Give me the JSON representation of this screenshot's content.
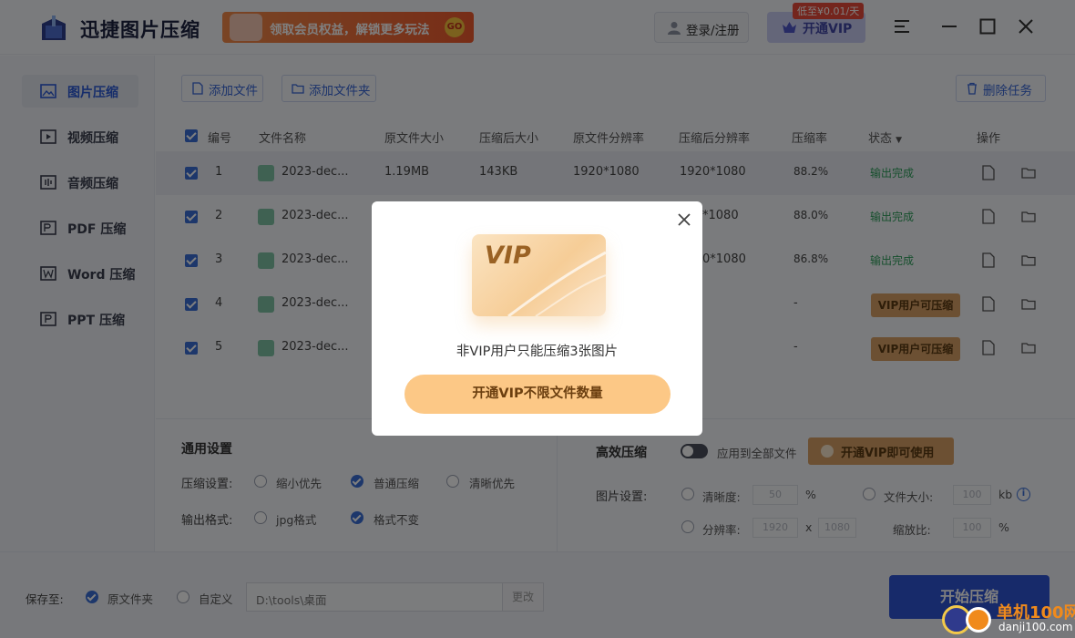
{
  "app": {
    "title": "迅捷图片压缩",
    "promo": "领取会员权益，解锁更多玩法",
    "promo_go": "GO",
    "login_label": "登录/注册",
    "vip_label": "开通VIP",
    "vip_badge": "低至¥0.01/天"
  },
  "sidebar": {
    "items": [
      {
        "label": "图片压缩",
        "icon": "image-icon",
        "active": true
      },
      {
        "label": "视频压缩",
        "icon": "video-icon",
        "active": false
      },
      {
        "label": "音频压缩",
        "icon": "audio-icon",
        "active": false
      },
      {
        "label": "PDF 压缩",
        "icon": "pdf-icon",
        "active": false
      },
      {
        "label": "Word 压缩",
        "icon": "word-icon",
        "active": false
      },
      {
        "label": "PPT 压缩",
        "icon": "ppt-icon",
        "active": false
      }
    ]
  },
  "toolbar": {
    "add_file": "添加文件",
    "add_folder": "添加文件夹",
    "delete_task": "删除任务"
  },
  "table": {
    "headers": {
      "index": "编号",
      "name": "文件名称",
      "orig_size": "原文件大小",
      "comp_size": "压缩后大小",
      "orig_res": "原文件分辨率",
      "comp_res": "压缩后分辨率",
      "ratio": "压缩率",
      "status": "状态",
      "ops": "操作"
    },
    "rows": [
      {
        "index": "1",
        "name": "2023-dec...",
        "orig_size": "1.19MB",
        "comp_size": "143KB",
        "orig_res": "1920*1080",
        "comp_res": "1920*1080",
        "ratio": "88.2%",
        "status": "输出完成"
      },
      {
        "index": "2",
        "name": "2023-dec...",
        "comp_res": "*1080",
        "ratio": "88.0%",
        "status": "输出完成"
      },
      {
        "index": "3",
        "name": "2023-dec...",
        "comp_res": "0*1080",
        "ratio": "86.8%",
        "status": "输出完成"
      },
      {
        "index": "4",
        "name": "2023-dec...",
        "ratio": "-",
        "status": "VIP用户可压缩"
      },
      {
        "index": "5",
        "name": "2023-dec...",
        "ratio": "-",
        "status": "VIP用户可压缩"
      }
    ]
  },
  "settings": {
    "general_title": "通用设置",
    "compress_label": "压缩设置:",
    "compress_options": [
      "缩小优先",
      "普通压缩",
      "清晰优先"
    ],
    "format_label": "输出格式:",
    "format_options": [
      "jpg格式",
      "格式不变"
    ],
    "efficient_title": "高效压缩",
    "apply_all": "应用到全部文件",
    "vip_use": "开通VIP即可使用",
    "image_settings_label": "图片设置:",
    "clarity_label": "清晰度:",
    "clarity_value": "50",
    "percent": "%",
    "filesize_label": "文件大小:",
    "filesize_value": "100",
    "kb": "kb",
    "resolution_label": "分辨率:",
    "res_w": "1920",
    "res_x": "x",
    "res_h": "1080",
    "scale_label": "缩放比:",
    "scale_value": "100",
    "info": "i"
  },
  "footer": {
    "save_to": "保存至:",
    "orig_folder": "原文件夹",
    "custom": "自定义",
    "path": "D:\\tools\\桌面",
    "change": "更改",
    "start": "开始压缩"
  },
  "modal": {
    "card_text": "VIP",
    "message": "非VIP用户只能压缩3张图片",
    "button": "开通VIP不限文件数量"
  },
  "watermark": {
    "name": "单机100网",
    "url": "danji100.com"
  },
  "colors": {
    "accent": "#3b6fd6",
    "vip_gold": "#d9a066",
    "modal_button": "#fcc886",
    "done_green": "#2c9f5a"
  }
}
